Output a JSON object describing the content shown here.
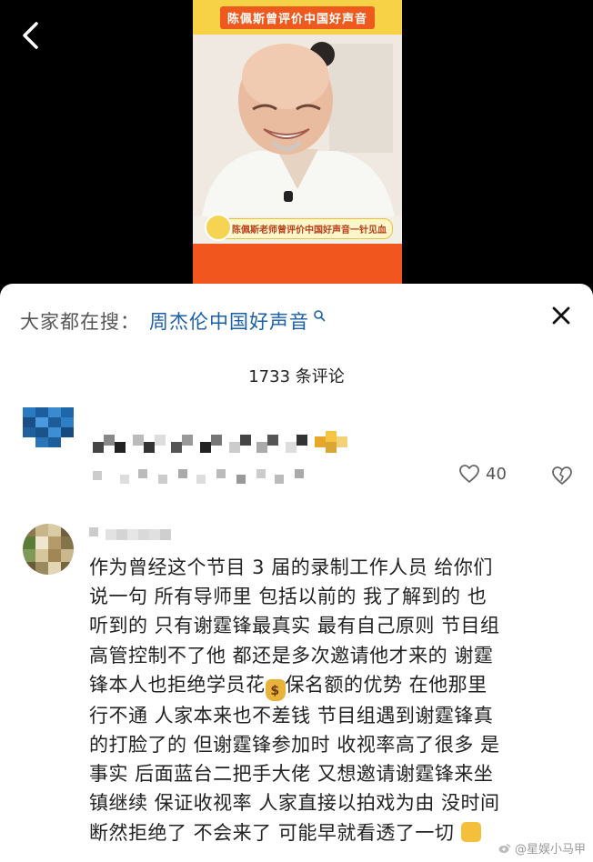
{
  "video": {
    "banner_text": "陈佩斯曾评价中国好声音",
    "caption_text": "陈佩斯老师曾评价中国好声音一针见血",
    "colors": {
      "banner": "#f7d247",
      "banner_label": "#ee5a1e",
      "footer": "#f2561f"
    }
  },
  "search": {
    "prefix": "大家都在搜：",
    "term": "周杰伦中国好声音",
    "term_color": "#1b5fa8"
  },
  "comments_header": {
    "count_text": "1733 条评论"
  },
  "comment1": {
    "like_count": "40"
  },
  "comment2": {
    "lines": [
      "作为曾经这个节目 3 届的录制工作人员 给你们",
      "说一句 所有导师里 包括以前的 我了解到的 也",
      "听到的 只有谢霆锋最真实 最有自己原则 节目组",
      "高管控制不了他 都还是多次邀请他才来的 谢霆",
      "锋本人也拒绝学员花",
      "保名额的优势 在他那里",
      "行不通 人家本来也不差钱 节目组遇到谢霆锋真",
      "的打脸了的 但谢霆锋参加时 收视率高了很多 是",
      "事实 后面蓝台二把手大佬 又想邀请谢霆锋来坐",
      "镇继续 保证收视率 人家直接以拍戏为由 没时间",
      "断然拒绝了 不会来了 可能早就看透了一切"
    ],
    "emoji_money": "$"
  },
  "watermark": "@星娱小马甲",
  "icons": [
    "back-arrow-icon",
    "search-icon",
    "close-icon",
    "heart-icon",
    "broken-heart-icon",
    "moneybag-icon",
    "thumbs-up-icon",
    "weibo-icon"
  ]
}
